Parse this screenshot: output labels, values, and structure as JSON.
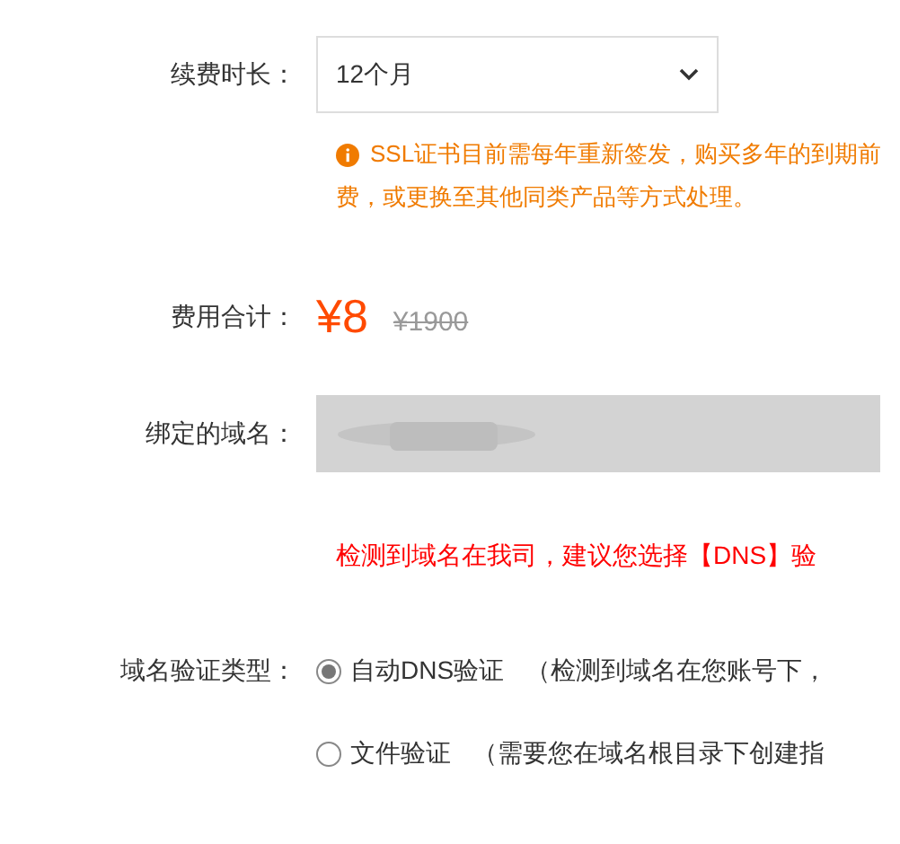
{
  "renewal": {
    "label": "续费时长：",
    "value": "12个月",
    "notice_lines": [
      "SSL证书目前需每年重新签发，购买多年的到期前",
      "费，或更换至其他同类产品等方式处理。"
    ]
  },
  "price": {
    "label": "费用合计：",
    "current": "¥8",
    "original": "¥1900"
  },
  "domain": {
    "label": "绑定的域名：",
    "disabled": true,
    "warning": "检测到域名在我司，建议您选择【DNS】验"
  },
  "verification": {
    "label": "域名验证类型：",
    "options": [
      {
        "label": "自动DNS验证",
        "hint": "（检测到域名在您账号下，",
        "selected": true
      },
      {
        "label": "文件验证",
        "hint": "（需要您在域名根目录下创建指",
        "selected": false
      }
    ]
  }
}
